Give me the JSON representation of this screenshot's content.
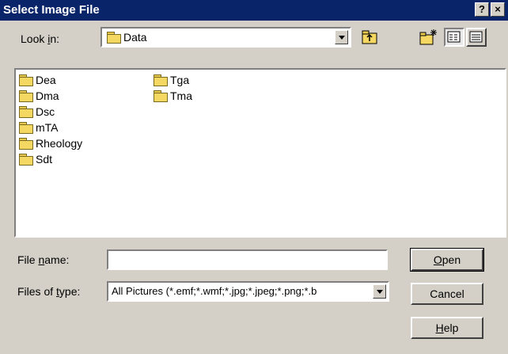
{
  "window": {
    "title": "Select Image File",
    "help_button": "?",
    "close_button": "×"
  },
  "look_in": {
    "label_pre": "Look ",
    "label_accel": "i",
    "label_post": "n:",
    "value": "Data"
  },
  "files": [
    {
      "name": "Dea",
      "type": "folder"
    },
    {
      "name": "Dma",
      "type": "folder"
    },
    {
      "name": "Dsc",
      "type": "folder"
    },
    {
      "name": "mTA",
      "type": "folder"
    },
    {
      "name": "Rheology",
      "type": "folder"
    },
    {
      "name": "Sdt",
      "type": "folder"
    },
    {
      "name": "Tga",
      "type": "folder"
    },
    {
      "name": "Tma",
      "type": "folder"
    }
  ],
  "file_name": {
    "label_pre": "File ",
    "label_accel": "n",
    "label_post": "ame:",
    "value": ""
  },
  "file_type": {
    "label_pre": "Files of ",
    "label_accel": "t",
    "label_post": "ype:",
    "value": "All Pictures (*.emf;*.wmf;*.jpg;*.jpeg;*.png;*.b"
  },
  "buttons": {
    "open_accel": "O",
    "open_rest": "pen",
    "cancel": "Cancel",
    "help_accel": "H",
    "help_rest": "elp"
  },
  "icons": [
    "folder-icon",
    "up-one-level-icon",
    "new-folder-icon",
    "list-view-icon",
    "details-view-icon",
    "dropdown-arrow-icon"
  ],
  "colors": {
    "titlebar": "#0a246a",
    "dialog_bg": "#d4d0c8",
    "folder": "#f4d861"
  }
}
